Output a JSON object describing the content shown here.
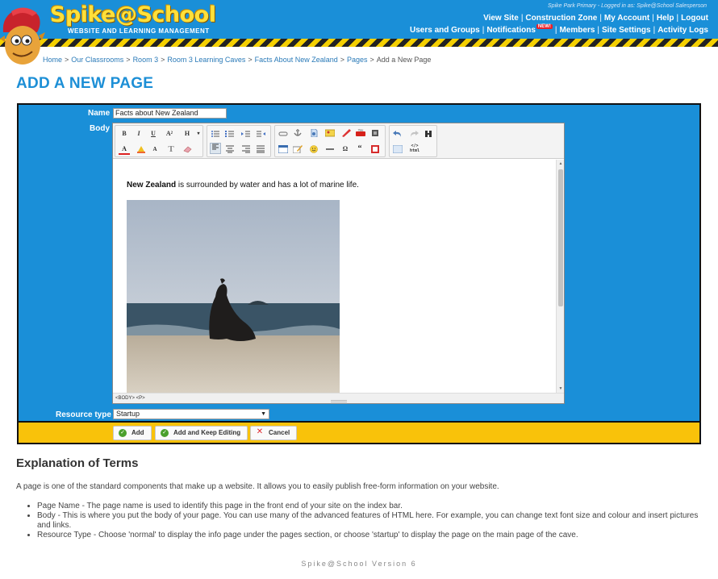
{
  "brand": {
    "logo_text": "Spike@School",
    "logo_subtitle": "WEBSITE AND LEARNING MANAGEMENT",
    "colors": {
      "header_blue": "#1a8fd8",
      "logo_yellow": "#ffe03a",
      "action_yellow": "#f9c20a",
      "title_blue": "#1d8fd6"
    }
  },
  "header": {
    "login_info": "Spike Park Primary - Logged in as: Spike@School Salesperson",
    "nav_row1": [
      "View Site",
      "Construction Zone",
      "My Account",
      "Help",
      "Logout"
    ],
    "nav_row2": {
      "users_groups": "Users and Groups",
      "notifications": "Notifications",
      "new_badge": "NEW!",
      "members": "Members",
      "site_settings": "Site Settings",
      "activity_logs": "Activity Logs"
    },
    "separator": "|"
  },
  "breadcrumb": {
    "items": [
      "Home",
      "Our Classrooms",
      "Room 3",
      "Room 3 Learning Caves",
      "Facts About New Zealand",
      "Pages"
    ],
    "current": "Add a New Page",
    "separator": ">"
  },
  "page_title": "ADD A NEW PAGE",
  "form": {
    "name_label": "Name",
    "name_value": "Facts about New Zealand",
    "body_label": "Body",
    "resource_label": "Resource type",
    "resource_value": "Startup"
  },
  "editor": {
    "toolbar_row1": [
      "B",
      "I",
      "U",
      "A²",
      "H"
    ],
    "toolbar_row2_text": [
      "A",
      "T"
    ],
    "body_text_bold": "New Zealand",
    "body_text_rest": " is surrounded by water and has a lot of marine life.",
    "status_path": "<BODY>  <P>",
    "icons": [
      "bold-icon",
      "italic-icon",
      "underline-icon",
      "superscript-icon",
      "heading-icon",
      "bullet-list-icon",
      "numbered-list-icon",
      "indent-icon",
      "outdent-icon",
      "text-color-icon",
      "highlight-icon",
      "font-icon",
      "text-style-icon",
      "eraser-icon",
      "align-left-icon",
      "align-center-icon",
      "align-right-icon",
      "justify-icon",
      "link-icon",
      "anchor-icon",
      "file-icon",
      "image-icon",
      "pen-icon",
      "youtube-icon",
      "media-icon",
      "table-icon",
      "edit-icon",
      "emoji-icon",
      "horizontal-rule-icon",
      "omega-icon",
      "quote-icon",
      "pdf-icon",
      "undo-icon",
      "redo-icon",
      "find-icon",
      "preview-icon",
      "html-icon"
    ]
  },
  "actions": {
    "add": "Add",
    "add_keep": "Add and Keep Editing",
    "cancel": "Cancel"
  },
  "explanation": {
    "title": "Explanation of Terms",
    "intro": "A page is one of the standard components that make up a website. It allows you to easily publish free-form information on your website.",
    "items": [
      "Page Name - The page name is used to identify this page in the front end of your site on the index bar.",
      "Body - This is where you put the body of your page. You can use many of the advanced features of HTML here. For example, you can change text font size and colour and insert pictures and links.",
      "Resource Type - Choose 'normal' to display the info page under the pages section, or choose 'startup' to display the page on the main page of the cave."
    ]
  },
  "footer": "Spike@School Version 6"
}
